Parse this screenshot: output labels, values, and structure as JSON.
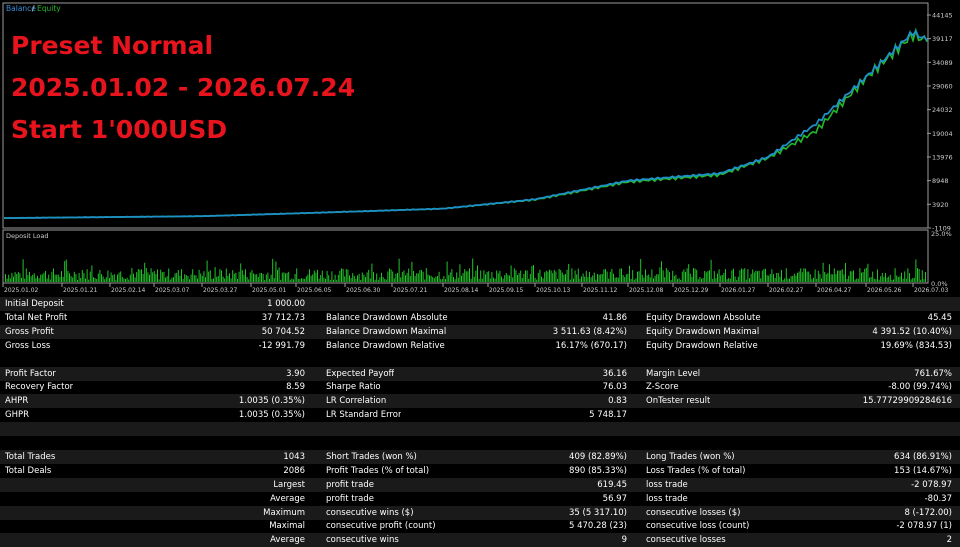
{
  "chart": {
    "legend_balance": "Balance",
    "legend_sep": " / ",
    "legend_equity": "Equity",
    "title_lines": [
      "Preset Normal",
      "2025.01.02 - 2026.07.24",
      "Start 1'000USD"
    ],
    "y_ticks": [
      "44145",
      "39117",
      "34089",
      "29060",
      "24032",
      "19004",
      "13976",
      "8948",
      "3920",
      "-1109"
    ],
    "deposit_load_label": "Deposit Load",
    "load_ticks": [
      "25.0%",
      "0.0%"
    ],
    "x_ticks": [
      "2025.01.02",
      "2025.01.21",
      "2025.02.14",
      "2025.03.07",
      "2025.03.27",
      "2025.05.01",
      "2025.06.05",
      "2025.06.30",
      "2025.07.21",
      "2025.08.14",
      "2025.09.15",
      "2025.10.13",
      "2025.11.12",
      "2025.12.08",
      "2025.12.29",
      "2026.01.27",
      "2026.02.27",
      "2026.04.27",
      "2026.05.26",
      "2026.07.03"
    ],
    "colors": {
      "balance": "#1e90c8",
      "equity": "#25b82a",
      "load": "#22c42a",
      "grid": "#333333"
    }
  },
  "chart_data": {
    "type": "line",
    "series": [
      {
        "name": "Balance",
        "x": [
          "2025.01.02",
          "2025.03.27",
          "2025.06.05",
          "2025.08.14",
          "2025.10.13",
          "2025.12.08",
          "2026.01.27",
          "2026.02.27",
          "2026.04.27",
          "2026.05.26",
          "2026.07.03",
          "2026.07.24"
        ],
        "values": [
          1000,
          1400,
          2000,
          3000,
          5000,
          8948,
          10500,
          13976,
          21000,
          31000,
          40500,
          38700
        ]
      },
      {
        "name": "Equity",
        "x": [
          "2025.01.02",
          "2025.03.27",
          "2025.06.05",
          "2025.08.14",
          "2025.10.13",
          "2025.12.08",
          "2026.01.27",
          "2026.02.27",
          "2026.04.27",
          "2026.05.26",
          "2026.07.03",
          "2026.07.24"
        ],
        "values": [
          1000,
          1400,
          2000,
          3000,
          4900,
          8700,
          10200,
          13800,
          19500,
          30800,
          40000,
          38500
        ]
      }
    ],
    "ylim": [
      -1109,
      44145
    ]
  },
  "stats": {
    "initial_deposit_label": "Initial Deposit",
    "initial_deposit": "1 000.00",
    "col1": [
      {
        "label": "Total Net Profit",
        "value": "37 712.73"
      },
      {
        "label": "Gross Profit",
        "value": "50 704.52"
      },
      {
        "label": "Gross Loss",
        "value": "-12 991.79"
      }
    ],
    "col2": [
      {
        "label": "Balance Drawdown Absolute",
        "value": "41.86"
      },
      {
        "label": "Balance Drawdown Maximal",
        "value": "3 511.63 (8.42%)"
      },
      {
        "label": "Balance Drawdown Relative",
        "value": "16.17% (670.17)"
      }
    ],
    "col3": [
      {
        "label": "Equity Drawdown Absolute",
        "value": "45.45"
      },
      {
        "label": "Equity Drawdown Maximal",
        "value": "4 391.52 (10.40%)"
      },
      {
        "label": "Equity Drawdown Relative",
        "value": "19.69% (834.53)"
      }
    ],
    "b1": [
      {
        "label": "Profit Factor",
        "value": "3.90"
      },
      {
        "label": "Recovery Factor",
        "value": "8.59"
      },
      {
        "label": "AHPR",
        "value": "1.0035 (0.35%)"
      },
      {
        "label": "GHPR",
        "value": "1.0035 (0.35%)"
      }
    ],
    "b2": [
      {
        "label": "Expected Payoff",
        "value": "36.16"
      },
      {
        "label": "Sharpe Ratio",
        "value": "76.03"
      },
      {
        "label": "LR Correlation",
        "value": "0.83"
      },
      {
        "label": "LR Standard Error",
        "value": "5 748.17"
      }
    ],
    "b3": [
      {
        "label": "Margin Level",
        "value": "761.67%"
      },
      {
        "label": "Z-Score",
        "value": "-8.00 (99.74%)"
      },
      {
        "label": "OnTester result",
        "value": "15.77729909284616"
      }
    ],
    "t1": [
      {
        "label": "Total Trades",
        "value": "1043"
      },
      {
        "label": "Total Deals",
        "value": "2086"
      },
      {
        "label": "",
        "value": "Largest"
      },
      {
        "label": "",
        "value": "Average"
      },
      {
        "label": "",
        "value": "Maximum"
      },
      {
        "label": "",
        "value": "Maximal"
      },
      {
        "label": "",
        "value": "Average"
      }
    ],
    "t2": [
      {
        "label": "Short Trades (won %)",
        "value": "409 (82.89%)"
      },
      {
        "label": "Profit Trades (% of total)",
        "value": "890 (85.33%)"
      },
      {
        "label": "profit trade",
        "value": "619.45"
      },
      {
        "label": "profit trade",
        "value": "56.97"
      },
      {
        "label": "consecutive wins ($)",
        "value": "35 (5 317.10)"
      },
      {
        "label": "consecutive profit (count)",
        "value": "5 470.28 (23)"
      },
      {
        "label": "consecutive wins",
        "value": "9"
      }
    ],
    "t3": [
      {
        "label": "Long Trades (won %)",
        "value": "634 (86.91%)"
      },
      {
        "label": "Loss Trades (% of total)",
        "value": "153 (14.67%)"
      },
      {
        "label": "loss trade",
        "value": "-2 078.97"
      },
      {
        "label": "loss trade",
        "value": "-80.37"
      },
      {
        "label": "consecutive losses ($)",
        "value": "8 (-172.00)"
      },
      {
        "label": "consecutive loss (count)",
        "value": "-2 078.97 (1)"
      },
      {
        "label": "consecutive losses",
        "value": "2"
      }
    ]
  }
}
